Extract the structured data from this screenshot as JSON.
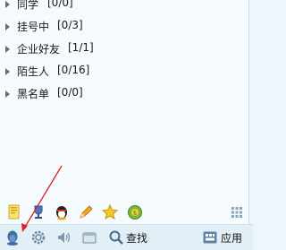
{
  "groups": [
    {
      "name": "同学",
      "count": "[0/0]"
    },
    {
      "name": "挂号中",
      "count": "[0/3]"
    },
    {
      "name": "企业好友",
      "count": "[1/1]"
    },
    {
      "name": "陌生人",
      "count": "[0/16]"
    },
    {
      "name": "黑名单",
      "count": "[0/0]"
    }
  ],
  "toolbar": {
    "row1_icons": [
      "notes-icon",
      "trophy-icon",
      "penguin-game-icon",
      "pencil-icon",
      "star-icon",
      "lucky-bag-icon",
      "grid-icon"
    ],
    "row2_icons": [
      "qq-penguin-icon",
      "settings-gear-icon",
      "volume-icon",
      "folder-icon",
      "search-icon",
      "app-icon"
    ],
    "find_label": "查找",
    "app_label": "应用"
  },
  "colors": {
    "background": "#eef6fb",
    "panel": "#f5fafd",
    "annotation_arrow": "#e02020"
  }
}
